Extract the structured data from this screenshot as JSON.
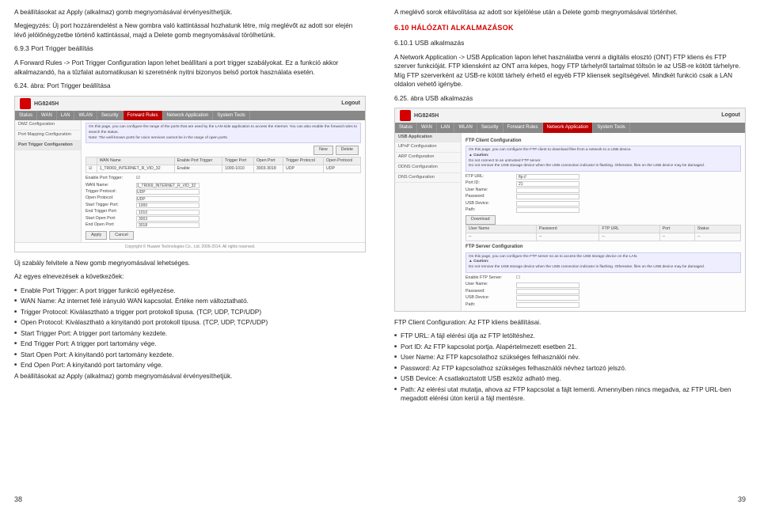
{
  "left": {
    "p1": "A beállításokat az Apply (alkalmaz) gomb megnyomásával érvényesíthetjük.",
    "p2": "Megjegyzés: Új port hozzárendelést a New gombra való kattintással hozhatunk létre, míg meglévőt az adott sor elején lévő jelölőnégyzetbe történő kattintással, majd a Delete gomb megnyomásával törölhetünk.",
    "sub1": "6.9.3 Port Trigger beállítás",
    "p3": "A Forward Rules -> Port Trigger Configuration lapon lehet beállítani a port trigger szabályokat. Ez a funkció akkor alkalmazandó, ha a tűzfalat automatikusan ki szeretnénk nyitni bizonyos belső portok használata esetén.",
    "caption1": "6.24. ábra: Port Trigger beállítása",
    "p4": "Új szabály felvitele a New gomb megnyomásával lehetséges.",
    "p5": "Az egyes elnevezések a következőek:",
    "li1": "Enable Port Trigger: A port trigger funkció egélyezése.",
    "li2": "WAN Name: Az internet felé irányuló WAN kapcsolat. Értéke nem változtatható.",
    "li3": "Trigger Protocol: Kiválasztható a trigger port protokoll típusa. (TCP, UDP, TCP/UDP)",
    "li4": "Open Protocol: Kiválasztható a kinyitandó port protokoll típusa. (TCP, UDP, TCP/UDP)",
    "li5": "Start Trigger Port: A trigger port tartomány kezdete.",
    "li6": "End Trigger Port: A trigger port tartomány vége.",
    "li7": "Start Open Port: A kinyitandó port tartomány kezdete.",
    "li8": "End Open Port: A kinyitandó port tartomány vége.",
    "p6": "A beállításokat az Apply (alkalmaz) gomb megnyomásával érvényesíthetjük.",
    "pagenum": "38",
    "router": {
      "title": "HG8245H",
      "logout": "Logout",
      "tabs": [
        "Status",
        "WAN",
        "LAN",
        "WLAN",
        "Security",
        "Forward Rules",
        "Network Application",
        "System Tools"
      ],
      "side": [
        "DMZ Configuration",
        "Port Mapping Configuration",
        "Port Trigger Configuration"
      ],
      "hint1": "On this page, you can configure the range of the ports that are used by the LAN-side application to access the Internet. You can also enable the forward rules to search the status.",
      "hint2": "Note: The well-known ports for voice services cannot be in the range of open ports.",
      "tbl_head": [
        "",
        "WAN Name",
        "Enable Port Trigger",
        "Trigger Port",
        "Open Port",
        "Trigger Protocol",
        "Open Protocol"
      ],
      "tbl_row": [
        "☑",
        "1_TR069_INTERNET_R_VID_32",
        "Enable",
        "1000-1010",
        "3003-3018",
        "UDP",
        "UDP"
      ],
      "new": "New",
      "delete": "Delete",
      "form": {
        "enable": "Enable Port Trigger:",
        "wan": "WAN Name:",
        "wanval": "1_TR069_INTERNET_R_VID_32",
        "trigproto": "Trigger Protocol:",
        "openproto": "Open Protocol:",
        "strig": "Start Trigger Port:",
        "strigv": "1000",
        "etrig": "End Trigger Port:",
        "etrigv": "1010",
        "sopen": "Start Open Port:",
        "sopenv": "3003",
        "eopen": "End Open Port:",
        "eopenv": "3018",
        "udp": "UDP"
      },
      "apply": "Apply",
      "cancel": "Cancel",
      "copy": "Copyright © Huawei Technologies Co., Ltd. 2009-2014. All rights reserved."
    }
  },
  "right": {
    "p1": "A meglévő sorok eltávolítása az adott sor kijelölése után a Delete gomb megnyomásával történhet.",
    "sec": "6.10 HÁLÓZATI ALKALMAZÁSOK",
    "sub1": "6.10.1 USB alkalmazás",
    "p2": "A Network Application -> USB Application lapon lehet használatba venni a digitális elosztó (ONT) FTP kliens és FTP szerver funkcióját. FTP kliensként az ONT arra képes, hogy FTP tárhelyről tartalmat töltsön le az USB-re kötött tárhelyre. Míg FTP szerverként az USB-re kötött tárhely érhető el egyéb FTP kliensek segítségével. Mindkét funkció csak a LAN oldalon vehető igénybe.",
    "cap": "6.25. ábra USB alkalmazás",
    "p3": "FTP Client Configuration: Az FTP kliens beállításai.",
    "li1": "FTP URL: A fájl elérési útja az FTP letöltéshez.",
    "li2": "Port ID: Az FTP kapcsolat portja. Alapértelmezett esetben 21.",
    "li3": "User Name: Az FTP kapcsolathoz szükséges felhasználói név.",
    "li4": "Password: Az FTP kapcsolathoz szükséges felhasználói névhez tartozó jelszó.",
    "li5": "USB Device: A csatlakoztatott USB eszköz adható meg.",
    "li6": "Path: Az elérési utat mutatja, ahova az FTP kapcsolat a fájlt lementi. Amennyiben nincs megadva, az FTP URL-ben megadott elérési úton kerül a fájl mentésre.",
    "pagenum": "39",
    "router": {
      "title": "HG8245H",
      "logout": "Logout",
      "tabs": [
        "Status",
        "WAN",
        "LAN",
        "WLAN",
        "Security",
        "Forward Rules",
        "Network Application",
        "System Tools"
      ],
      "side": [
        "USB Application",
        "UPnP Configuration",
        "ARP Configuration",
        "DDNS Configuration",
        "DNS Configuration"
      ],
      "sect1": "FTP Client Configuration",
      "hint1": "On this page, you can configure the FTP client to download files from a network to a USB device.",
      "caution": "▲ Caution:",
      "caution1": "Do not connect to an untrusted FTP server.",
      "caution2": "Do not remove the USB storage device when the USB connection indicator is flashing. Otherwise, files on the USB device may be damaged.",
      "form": {
        "ftpurl": "FTP URL:",
        "ftpurlv": "ftp://",
        "port": "Port ID:",
        "portv": "21",
        "user": "User Name:",
        "pass": "Password:",
        "usbdev": "USB Device:",
        "path": "Path:",
        "download": "Download"
      },
      "tbl": [
        "User Name",
        "Password",
        "FTP URL",
        "Port",
        "Status"
      ],
      "sect2": "FTP Server Configuration",
      "hint2": "On this page, you can configure the FTP server so as to access the USB storage device on the LAN.",
      "caution3": "Do not remove the USB storage device when the USB connection indicator is flashing. Otherwise, files on the USB device may be damaged.",
      "form2": {
        "enable": "Enable FTP Server:",
        "user": "User Name:",
        "pass": "Password:",
        "usbdev": "USB Device:",
        "path": "Path:"
      }
    }
  }
}
